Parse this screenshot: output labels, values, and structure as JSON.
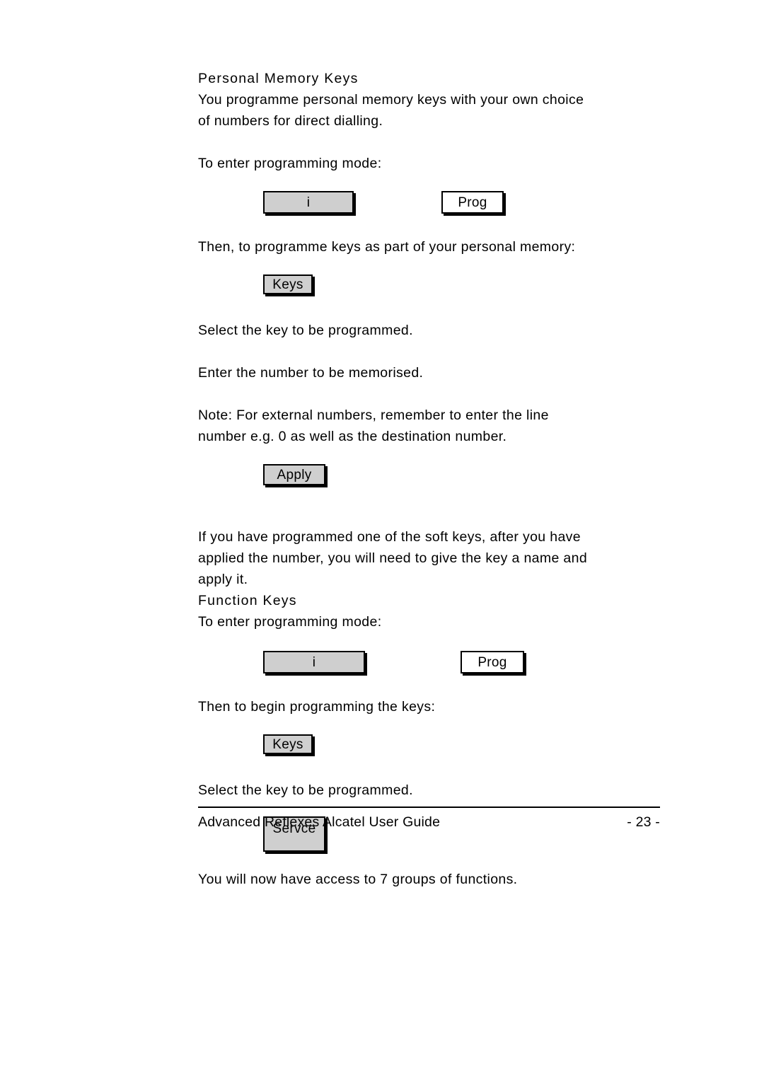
{
  "document": {
    "page_number_label": "- 23 -",
    "footer_title": "Advanced Reflexes Alcatel User Guide"
  },
  "sections": [
    {
      "heading": "Personal Memory Keys",
      "paragraphs": [
        "You programme personal memory keys with your own choice",
        "of numbers for direct dialling.",
        "To enter programming mode:",
        "Then, to programme keys as part of your personal memory:",
        "Select the key to be programmed.",
        "Enter the number to be memorised.",
        "Note:  For external numbers, remember to enter the line",
        "number e.g. 0 as well as the destination number.",
        "If you have programmed one of the soft keys, after you have",
        "applied the number, you will need to give the key a name and",
        "apply it."
      ]
    },
    {
      "heading": "Function Keys",
      "paragraphs": [
        "To enter programming mode:",
        "Then to begin programming the keys:",
        "Select the key to be programmed.",
        "You will now have access to 7 groups of functions."
      ]
    }
  ],
  "keys": {
    "info_1": "i",
    "prog_1": "Prog",
    "keys_1": "Keys",
    "apply": "Apply",
    "info_2": "i",
    "prog_2": "Prog",
    "keys_2": "Keys",
    "service": "Servce"
  },
  "colors": {
    "key_fill": "#cfcfcf",
    "key_fill_white": "#ffffff",
    "border": "#000000",
    "text": "#000000",
    "page_background": "#ffffff"
  }
}
